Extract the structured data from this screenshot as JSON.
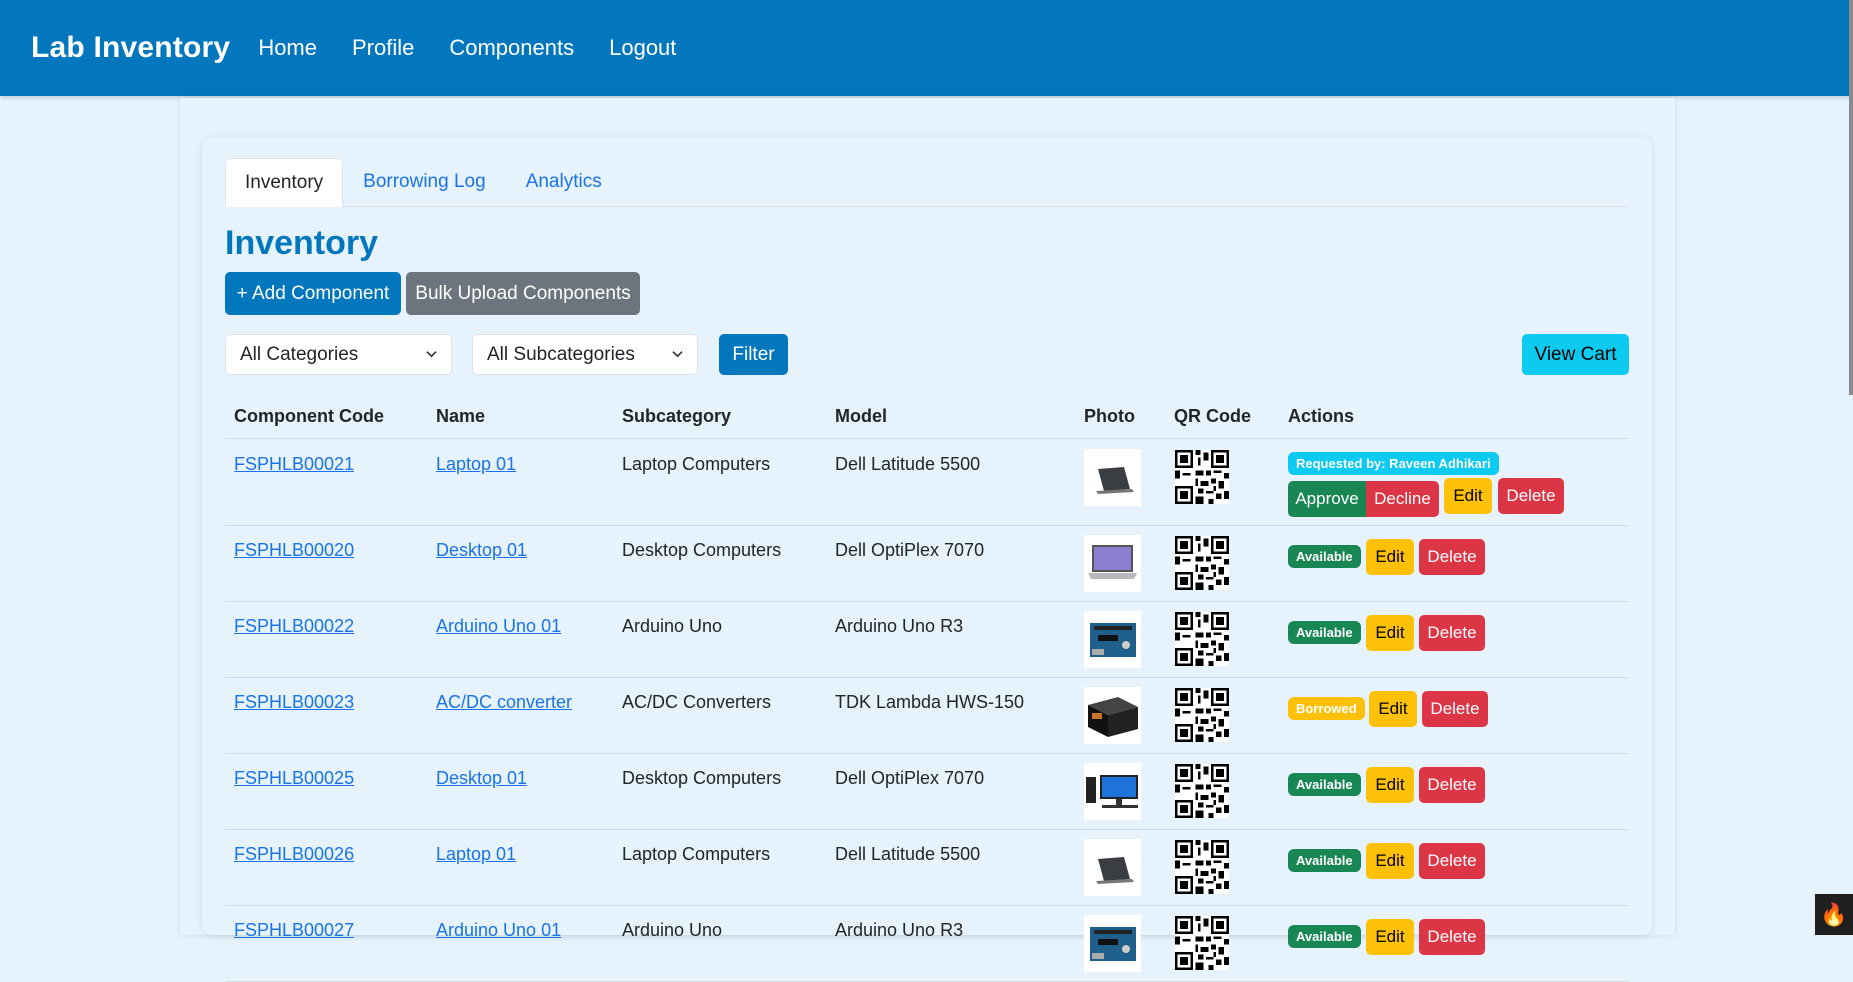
{
  "navbar": {
    "brand": "Lab Inventory",
    "links": [
      "Home",
      "Profile",
      "Components",
      "Logout"
    ]
  },
  "tabs": [
    "Inventory",
    "Borrowing Log",
    "Analytics"
  ],
  "page_title": "Inventory",
  "buttons": {
    "add": "+ Add Component",
    "bulk": "Bulk Upload Components",
    "filter": "Filter",
    "cart": "View Cart"
  },
  "filters": {
    "category": "All Categories",
    "subcategory": "All Subcategories"
  },
  "table": {
    "headers": [
      "Component Code",
      "Name",
      "Subcategory",
      "Model",
      "Photo",
      "QR Code",
      "Actions"
    ],
    "rows": [
      {
        "code": "FSPHLB00021",
        "name": "Laptop 01",
        "subcategory": "Laptop Computers",
        "model": "Dell Latitude 5500",
        "photo": "laptop-photo",
        "status": "requested",
        "status_text": "Requested by: Raveen Adhikari"
      },
      {
        "code": "FSPHLB00020",
        "name": "Desktop 01",
        "subcategory": "Desktop Computers",
        "model": "Dell OptiPlex 7070",
        "photo": "laptop-open-photo",
        "status": "available",
        "status_text": "Available"
      },
      {
        "code": "FSPHLB00022",
        "name": "Arduino Uno 01",
        "subcategory": "Arduino Uno",
        "model": "Arduino Uno R3",
        "photo": "arduino-photo",
        "status": "available",
        "status_text": "Available"
      },
      {
        "code": "FSPHLB00023",
        "name": "AC/DC converter",
        "subcategory": "AC/DC Converters",
        "model": "TDK Lambda HWS-150",
        "photo": "power-supply-photo",
        "status": "borrowed",
        "status_text": "Borrowed"
      },
      {
        "code": "FSPHLB00025",
        "name": "Desktop 01",
        "subcategory": "Desktop Computers",
        "model": "Dell OptiPlex 7070",
        "photo": "desktop-photo",
        "status": "available",
        "status_text": "Available"
      },
      {
        "code": "FSPHLB00026",
        "name": "Laptop 01",
        "subcategory": "Laptop Computers",
        "model": "Dell Latitude 5500",
        "photo": "laptop-photo",
        "status": "available",
        "status_text": "Available"
      },
      {
        "code": "FSPHLB00027",
        "name": "Arduino Uno 01",
        "subcategory": "Arduino Uno",
        "model": "Arduino Uno R3",
        "photo": "arduino-photo",
        "status": "available",
        "status_text": "Available"
      }
    ],
    "action_labels": {
      "approve": "Approve",
      "decline": "Decline",
      "edit": "Edit",
      "delete": "Delete"
    }
  },
  "colors": {
    "navbar": "#0277bd",
    "background": "#e6f3fc",
    "link": "#1a73e8",
    "available": "#198754",
    "borrowed": "#ffc107",
    "requested": "#0dcaf0",
    "delete": "#dc3545",
    "edit": "#ffc107"
  }
}
